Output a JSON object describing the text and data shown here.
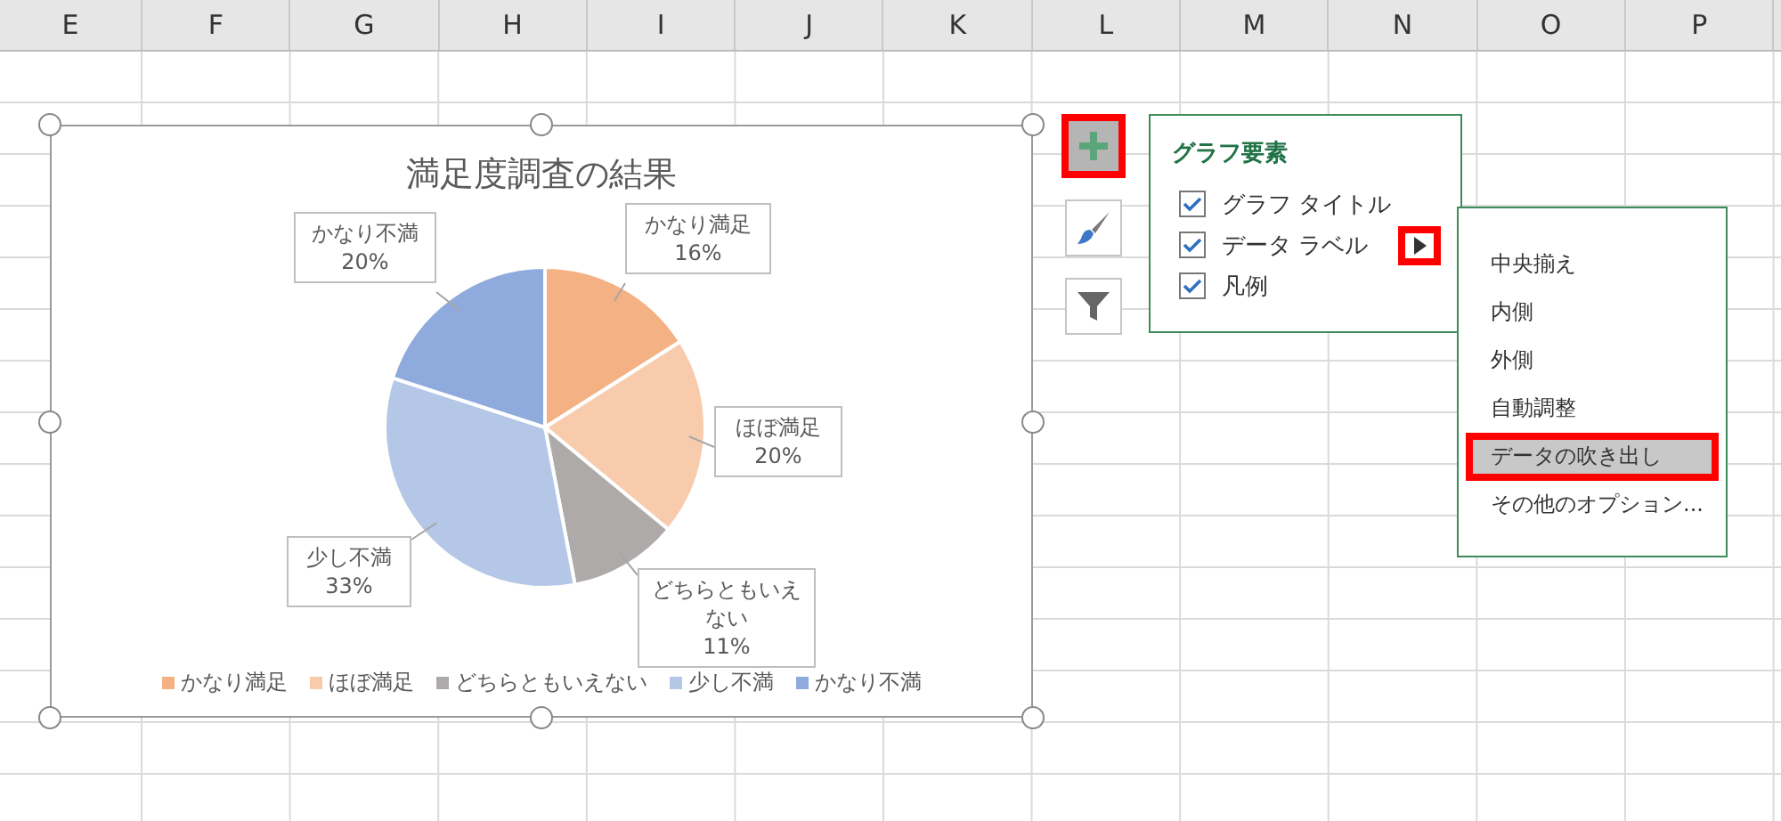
{
  "sheet": {
    "columns": [
      "E",
      "F",
      "G",
      "H",
      "I",
      "J",
      "K",
      "L",
      "M",
      "N",
      "O",
      "P"
    ]
  },
  "chart": {
    "chart_data": {
      "type": "pie",
      "title": "満足度調査の結果",
      "categories": [
        "かなり満足",
        "ほぼ満足",
        "どちらともいえない",
        "少し不満",
        "かなり不満"
      ],
      "values": [
        16,
        20,
        11,
        33,
        20
      ],
      "legend": "bottom"
    },
    "slices": [
      {
        "color": "#f4b183"
      },
      {
        "color": "#f8cbad"
      },
      {
        "color": "#aeaaaa"
      },
      {
        "color": "#b4c7e7"
      },
      {
        "color": "#8faadc"
      }
    ],
    "callouts": [
      {
        "name": "かなり不満",
        "percent": "20%"
      },
      {
        "name": "かなり満足",
        "percent": "16%"
      },
      {
        "name": "ほぼ満足",
        "percent": "20%"
      },
      {
        "name": "少し不満",
        "percent": "33%"
      },
      {
        "name": "どちらともいえない",
        "percent": "11%"
      }
    ]
  },
  "chart_tools": [
    {
      "kind": "elements",
      "selected": true
    },
    {
      "kind": "styles",
      "selected": false
    },
    {
      "kind": "filters",
      "selected": false
    }
  ],
  "elements_panel": {
    "title": "グラフ要素",
    "items": [
      {
        "label": "グラフ タイトル",
        "checked": true,
        "submenu_open": false
      },
      {
        "label": "データ ラベル",
        "checked": true,
        "submenu_open": true
      },
      {
        "label": "凡例",
        "checked": true,
        "submenu_open": false
      }
    ]
  },
  "label_menu": {
    "items": [
      {
        "label": "中央揃え",
        "selected": false
      },
      {
        "label": "内側",
        "selected": false
      },
      {
        "label": "外側",
        "selected": false
      },
      {
        "label": "自動調整",
        "selected": false
      },
      {
        "label": "データの吹き出し",
        "selected": true
      },
      {
        "label": "その他のオプション...",
        "selected": false
      }
    ]
  }
}
